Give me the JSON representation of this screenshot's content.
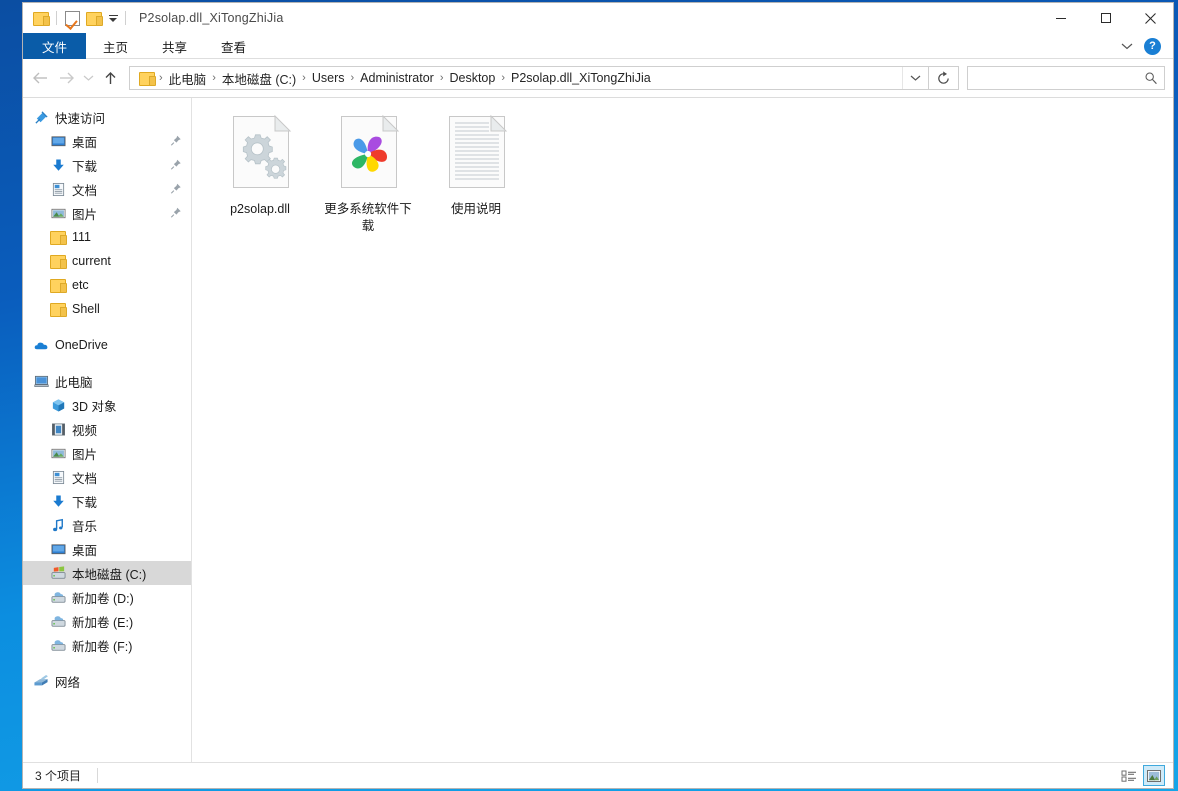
{
  "window": {
    "title": "P2solap.dll_XiTongZhiJia",
    "quick_access_toolbar": [
      {
        "name": "folder-icon",
        "label": ""
      },
      {
        "name": "properties-checkbox-icon",
        "label": ""
      },
      {
        "name": "new-folder-icon",
        "label": ""
      }
    ],
    "controls": {
      "minimize": "—",
      "maximize": "□",
      "close": "✕"
    },
    "border_color": "#0b4ea2",
    "accent_color": "#0a5ca8"
  },
  "ribbon": {
    "tabs": [
      {
        "label": "文件",
        "active": true
      },
      {
        "label": "主页",
        "active": false
      },
      {
        "label": "共享",
        "active": false
      },
      {
        "label": "查看",
        "active": false
      }
    ],
    "collapse_icon": "chevron-down-icon",
    "help_label": "?"
  },
  "address": {
    "back_icon": "arrow-left-icon",
    "forward_icon": "arrow-right-icon",
    "recent_icon": "chevron-down-icon",
    "up_icon": "arrow-up-icon",
    "folder_icon": "folder-icon",
    "crumbs": [
      "此电脑",
      "本地磁盘 (C:)",
      "Users",
      "Administrator",
      "Desktop",
      "P2solap.dll_XiTongZhiJia"
    ],
    "separator": "›",
    "dropdown_icon": "chevron-down-icon",
    "refresh_icon": "refresh-icon"
  },
  "search": {
    "value": "",
    "placeholder": "",
    "icon": "search-icon"
  },
  "sidebar": {
    "groups": [
      {
        "header": {
          "label": "快速访问",
          "icon": "star-pin-icon",
          "level": 0
        },
        "items": [
          {
            "label": "桌面",
            "icon": "desktop-icon",
            "pinned": true
          },
          {
            "label": "下载",
            "icon": "download-icon",
            "pinned": true
          },
          {
            "label": "文档",
            "icon": "documents-icon",
            "pinned": true
          },
          {
            "label": "图片",
            "icon": "pictures-icon",
            "pinned": true
          },
          {
            "label": "111",
            "icon": "folder-icon",
            "pinned": false
          },
          {
            "label": "current",
            "icon": "folder-icon",
            "pinned": false
          },
          {
            "label": "etc",
            "icon": "folder-icon",
            "pinned": false
          },
          {
            "label": "Shell",
            "icon": "folder-icon",
            "pinned": false
          }
        ]
      },
      {
        "header": {
          "label": "OneDrive",
          "icon": "cloud-icon",
          "level": 0
        },
        "items": []
      },
      {
        "header": {
          "label": "此电脑",
          "icon": "computer-icon",
          "level": 0
        },
        "items": [
          {
            "label": "3D 对象",
            "icon": "3d-objects-icon",
            "selected": false
          },
          {
            "label": "视频",
            "icon": "videos-icon",
            "selected": false
          },
          {
            "label": "图片",
            "icon": "pictures-icon",
            "selected": false
          },
          {
            "label": "文档",
            "icon": "documents-icon",
            "selected": false
          },
          {
            "label": "下载",
            "icon": "download-icon",
            "selected": false
          },
          {
            "label": "音乐",
            "icon": "music-icon",
            "selected": false
          },
          {
            "label": "桌面",
            "icon": "desktop-icon",
            "selected": false
          },
          {
            "label": "本地磁盘 (C:)",
            "icon": "drive-windows-icon",
            "selected": true
          },
          {
            "label": "新加卷 (D:)",
            "icon": "drive-icon",
            "selected": false
          },
          {
            "label": "新加卷 (E:)",
            "icon": "drive-icon",
            "selected": false
          },
          {
            "label": "新加卷 (F:)",
            "icon": "drive-icon",
            "selected": false
          }
        ]
      },
      {
        "header": {
          "label": "网络",
          "icon": "network-icon",
          "level": 0
        },
        "items": []
      }
    ]
  },
  "files": [
    {
      "name": "p2solap.dll",
      "icon": "dll-gears-icon"
    },
    {
      "name": "更多系统软件下载",
      "icon": "internet-shortcut-pinwheel-icon"
    },
    {
      "name": "使用说明",
      "icon": "text-document-icon"
    }
  ],
  "statusbar": {
    "item_count": "3 个项目",
    "views": [
      {
        "name": "details-view",
        "active": false
      },
      {
        "name": "large-icons-view",
        "active": true
      }
    ]
  }
}
